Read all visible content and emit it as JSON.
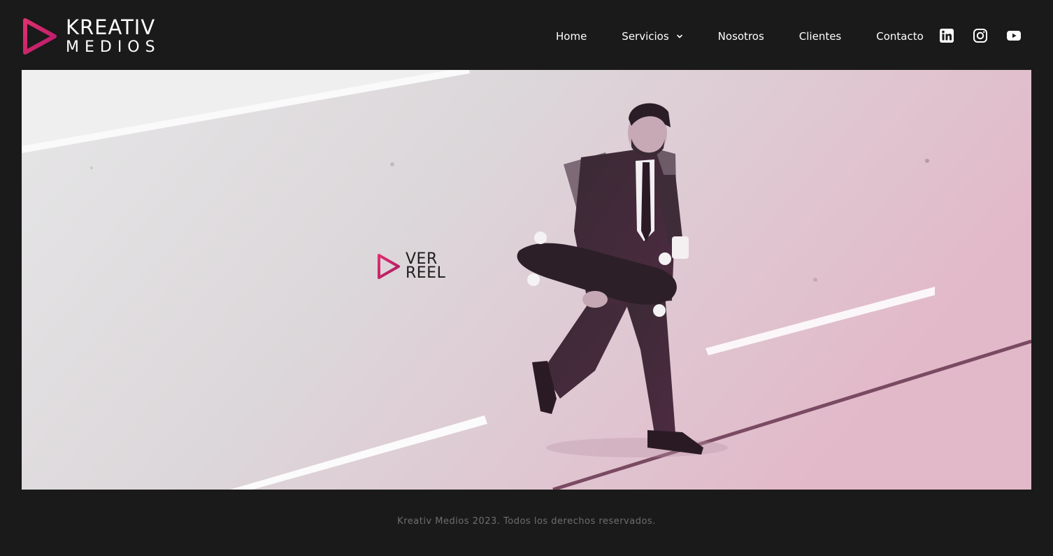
{
  "brand": {
    "line1": "KREATIV",
    "line2": "MEDIOS",
    "accent_color": "#d4266f",
    "icon": "play-triangle-icon"
  },
  "nav": {
    "items": [
      {
        "label": "Home"
      },
      {
        "label": "Servicios",
        "has_dropdown": true
      },
      {
        "label": "Nosotros"
      },
      {
        "label": "Clientes"
      },
      {
        "label": "Contacto"
      }
    ]
  },
  "social": [
    {
      "icon": "linkedin-icon"
    },
    {
      "icon": "instagram-icon"
    },
    {
      "icon": "youtube-icon"
    }
  ],
  "hero": {
    "reel_line1": "VER",
    "reel_line2": "REEL",
    "reel_icon": "play-triangle-icon",
    "image": "man-in-suit-carrying-skateboard-crossing-road"
  },
  "footer": {
    "text": "Kreativ Medios 2023. Todos los derechos reservados."
  },
  "colors": {
    "background": "#1a1a1a",
    "accent": "#d4266f",
    "footer_text": "#6e6e6e"
  }
}
